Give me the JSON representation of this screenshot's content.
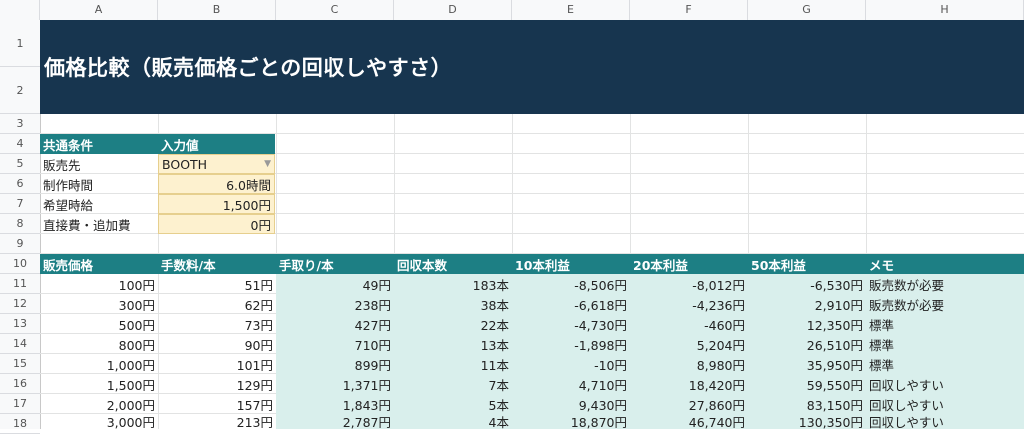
{
  "columns": [
    "A",
    "B",
    "C",
    "D",
    "E",
    "F",
    "G",
    "H"
  ],
  "rows": [
    "1",
    "2",
    "3",
    "4",
    "5",
    "6",
    "7",
    "8",
    "9",
    "10",
    "11",
    "12",
    "13",
    "14",
    "15",
    "16",
    "17",
    "18"
  ],
  "title": "価格比較（販売価格ごとの回収しやすさ）",
  "conditions": {
    "header_label": "共通条件",
    "header_value": "入力値",
    "items": [
      {
        "label": "販売先",
        "value": "BOOTH"
      },
      {
        "label": "制作時間",
        "value": "6.0時間"
      },
      {
        "label": "希望時給",
        "value": "1,500円"
      },
      {
        "label": "直接費・追加費",
        "value": "0円"
      }
    ]
  },
  "table": {
    "headers": [
      "販売価格",
      "手数料/本",
      "手取り/本",
      "回収本数",
      "10本利益",
      "20本利益",
      "50本利益",
      "メモ"
    ],
    "rows": [
      [
        "100円",
        "51円",
        "49円",
        "183本",
        "-8,506円",
        "-8,012円",
        "-6,530円",
        "販売数が必要"
      ],
      [
        "300円",
        "62円",
        "238円",
        "38本",
        "-6,618円",
        "-4,236円",
        "2,910円",
        "販売数が必要"
      ],
      [
        "500円",
        "73円",
        "427円",
        "22本",
        "-4,730円",
        "-460円",
        "12,350円",
        "標準"
      ],
      [
        "800円",
        "90円",
        "710円",
        "13本",
        "-1,898円",
        "5,204円",
        "26,510円",
        "標準"
      ],
      [
        "1,000円",
        "101円",
        "899円",
        "11本",
        "-10円",
        "8,980円",
        "35,950円",
        "標準"
      ],
      [
        "1,500円",
        "129円",
        "1,371円",
        "7本",
        "4,710円",
        "18,420円",
        "59,550円",
        "回収しやすい"
      ],
      [
        "2,000円",
        "157円",
        "1,843円",
        "5本",
        "9,430円",
        "27,860円",
        "83,150円",
        "回収しやすい"
      ],
      [
        "3,000円",
        "213円",
        "2,787円",
        "4本",
        "18,870円",
        "46,740円",
        "130,350円",
        "回収しやすい"
      ]
    ]
  },
  "colors": {
    "title_bg": "#17354f",
    "header_bg": "#1d7f84",
    "input_bg": "#fdf1cf",
    "calc_bg": "#d9efec"
  }
}
